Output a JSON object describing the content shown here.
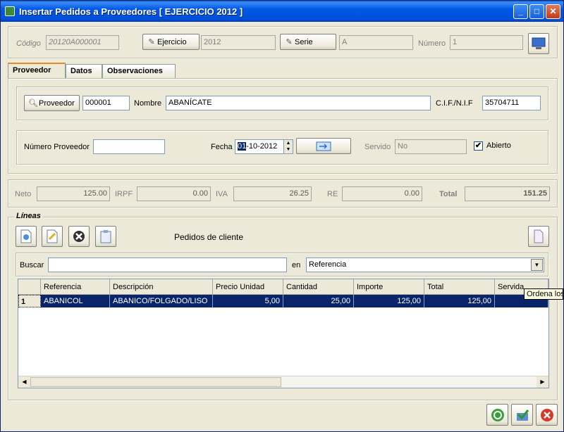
{
  "window": {
    "title": "Insertar Pedidos a Proveedores [ EJERCICIO 2012 ]",
    "minimize_label": "_",
    "maximize_label": "□",
    "close_label": "✕"
  },
  "header": {
    "codigo_label": "Código",
    "codigo_value": "20120A000001",
    "ejercicio_label": "Ejercicio",
    "ejercicio_value": "2012",
    "serie_label": "Serie",
    "serie_value": "A",
    "numero_label": "Número",
    "numero_value": "1"
  },
  "tabs": [
    {
      "label": "Proveedor"
    },
    {
      "label": "Datos"
    },
    {
      "label": "Observaciones"
    }
  ],
  "proveedor": {
    "button_label": "Proveedor",
    "code_value": "000001",
    "nombre_label": "Nombre",
    "nombre_value": "ABANÍCATE",
    "cif_label": "C.I.F./N.I.F",
    "cif_value": "35704711",
    "numero_proveedor_label": "Número Proveedor",
    "numero_proveedor_value": "",
    "fecha_label": "Fecha",
    "fecha_day": "01",
    "fecha_rest": "-10-2012",
    "servido_label": "Servido",
    "servido_value": "No",
    "abierto_label": "Abierto",
    "abierto_checked": "✔"
  },
  "totals": {
    "neto_label": "Neto",
    "neto_value": "125.00",
    "irpf_label": "IRPF",
    "irpf_value": "0.00",
    "iva_label": "IVA",
    "iva_value": "26.25",
    "re_label": "RE",
    "re_value": "0.00",
    "total_label": "Total",
    "total_value": "151.25"
  },
  "lineas": {
    "group_label": "Líneas",
    "pedidos_cliente_label": "Pedidos de cliente",
    "buscar_label": "Buscar",
    "buscar_value": "",
    "en_label": "en",
    "en_value": "Referencia",
    "columns": [
      "Referencia",
      "Descripción",
      "Precio Unidad",
      "Cantidad",
      "Importe",
      "Total",
      "Servida"
    ],
    "rows": [
      {
        "n": "1",
        "referencia": "ABANICOL",
        "descripcion": "ABANICO/FOLGADO/LISO",
        "precio": "5,00",
        "cantidad": "25,00",
        "importe": "125,00",
        "total": "125,00",
        "servida": ""
      }
    ],
    "tooltip": "Ordena los"
  },
  "colors": {
    "titlebar": "#0058e6",
    "selection": "#0a246a",
    "window_bg": "#ece9d8"
  }
}
